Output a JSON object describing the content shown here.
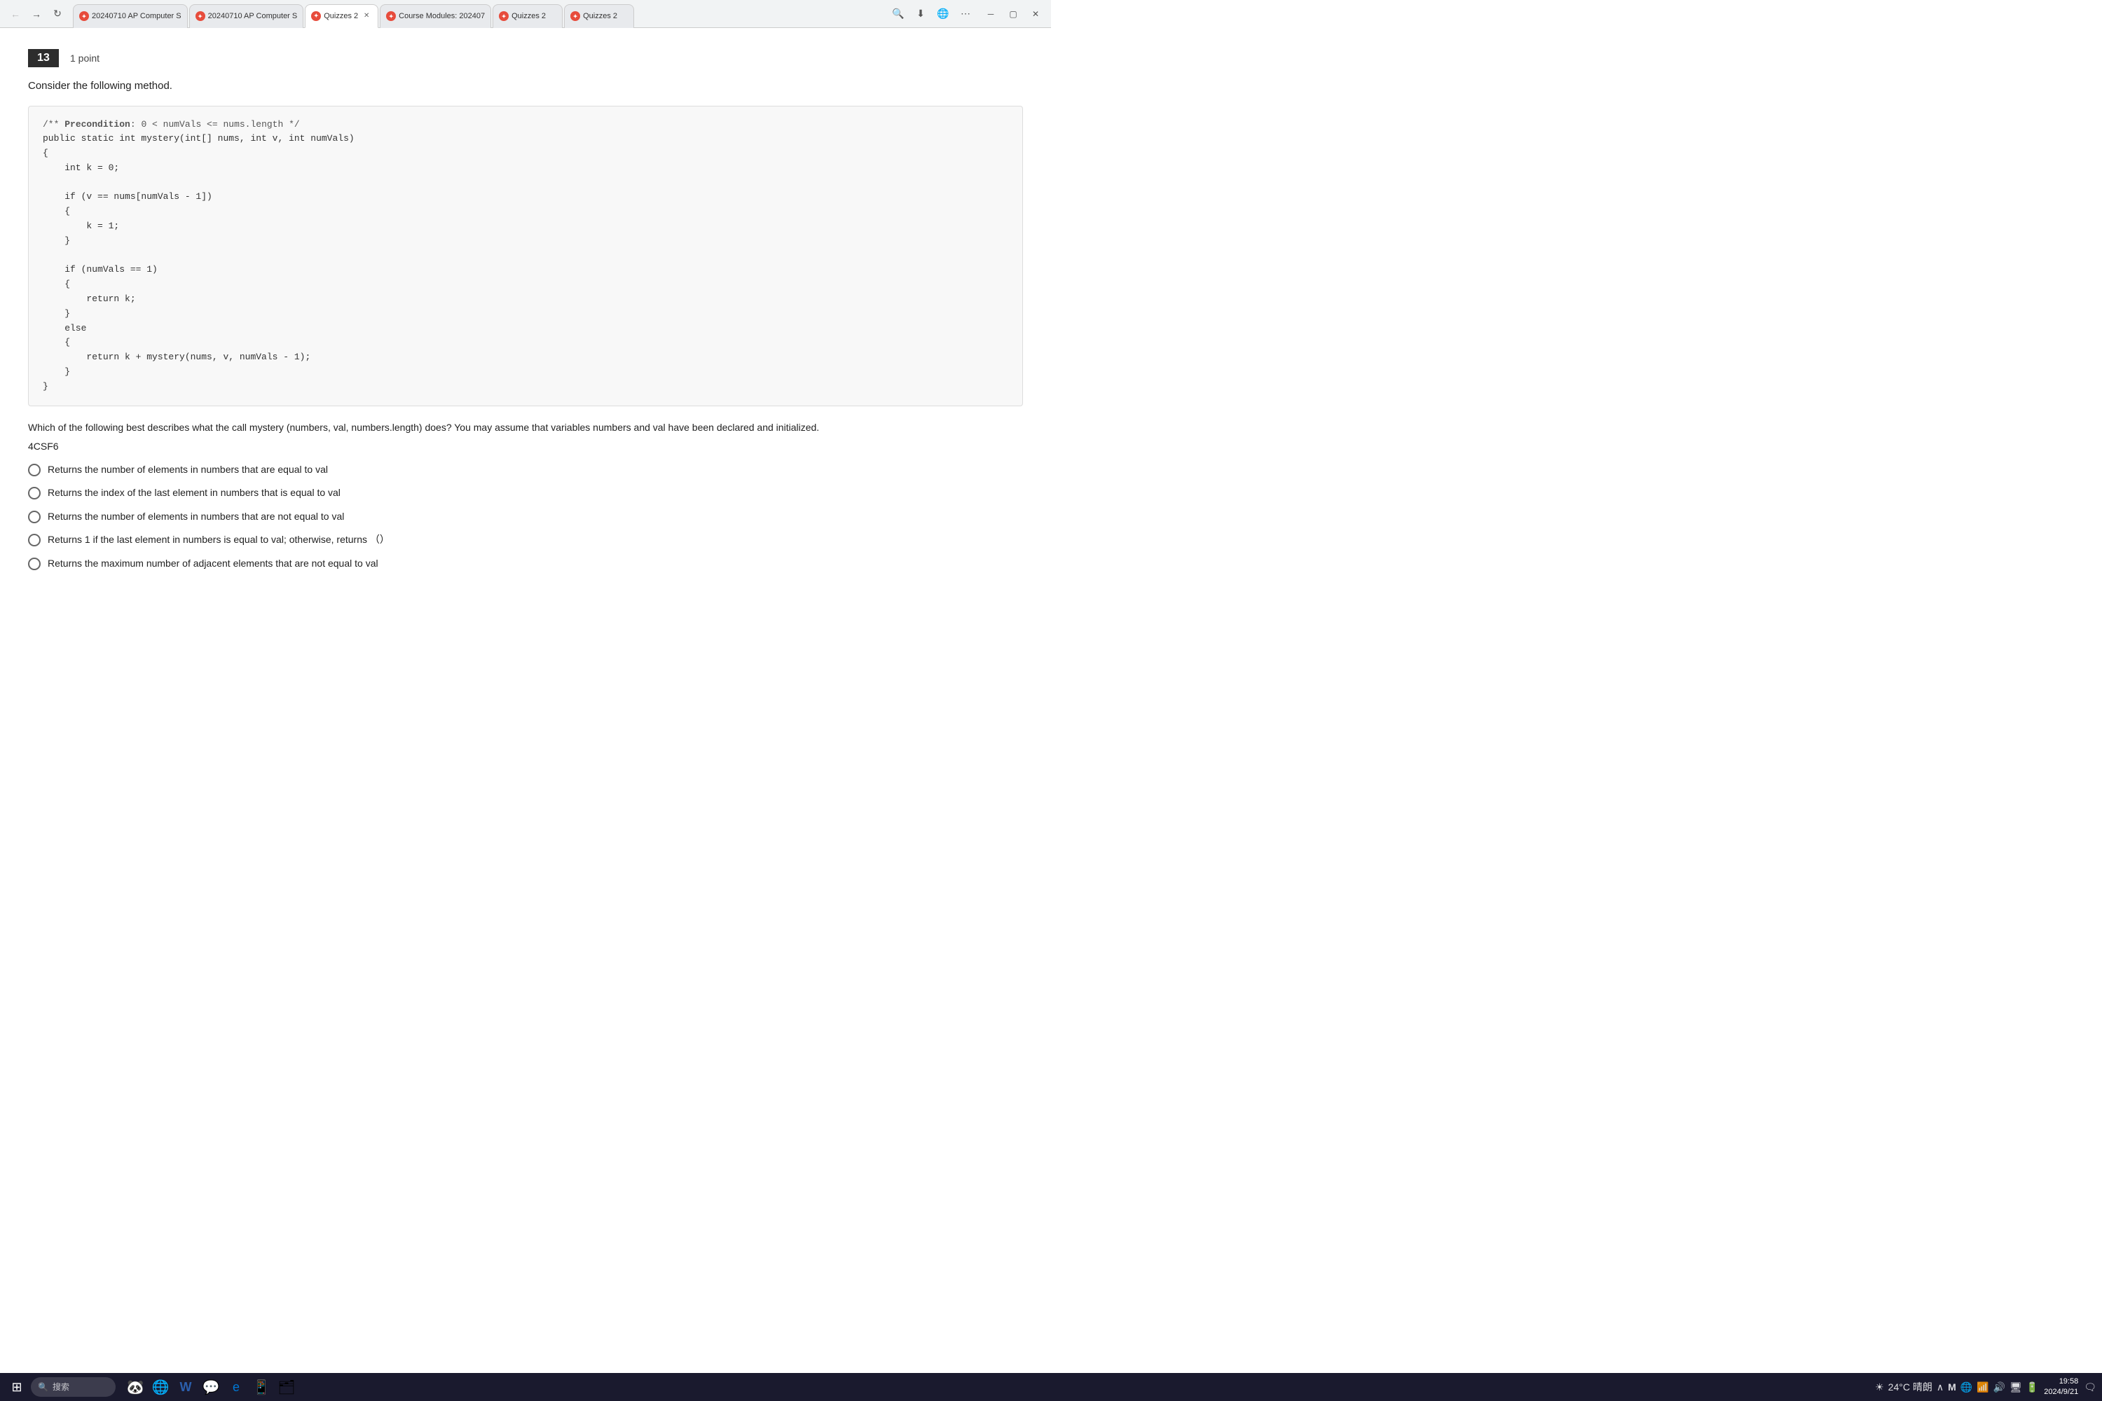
{
  "browser": {
    "tabs": [
      {
        "id": "tab1",
        "title": "20240710 AP Computer S",
        "active": false,
        "favicon": "🔴"
      },
      {
        "id": "tab2",
        "title": "20240710 AP Computer S",
        "active": false,
        "favicon": "🔴"
      },
      {
        "id": "tab3",
        "title": "Quizzes 2",
        "active": true,
        "favicon": "🔴",
        "closeable": true
      },
      {
        "id": "tab4",
        "title": "Course Modules: 202407",
        "active": false,
        "favicon": "🔴"
      },
      {
        "id": "tab5",
        "title": "Quizzes 2",
        "active": false,
        "favicon": "🔴"
      },
      {
        "id": "tab6",
        "title": "Quizzes 2",
        "active": false,
        "favicon": "🔴"
      }
    ],
    "actions": [
      "search",
      "download",
      "globe",
      "more"
    ]
  },
  "question": {
    "number": "13",
    "points": "1 point",
    "intro": "Consider the following method.",
    "code": "/** Precondition: 0 < numVals <= nums.length */\npublic static int mystery(int[] nums, int v, int numVals)\n{\n    int k = 0;\n\n    if (v == nums[numVals - 1])\n    {\n        k = 1;\n    }\n\n    if (numVals == 1)\n    {\n        return k;\n    }\n    else\n    {\n        return k + mystery(nums, v, numVals - 1);\n    }\n}",
    "question_text": "Which of the following best describes what the call mystery (numbers, val, numbers.length) does? You may assume that variables numbers and val have been declared and initialized.",
    "tag": "4CSF6",
    "options": [
      {
        "id": "A",
        "text": "Returns the number of elements in numbers that are equal to val"
      },
      {
        "id": "B",
        "text": "Returns the index of the last element in numbers that is equal to val"
      },
      {
        "id": "C",
        "text": "Returns the number of elements in numbers that are not equal to val"
      },
      {
        "id": "D",
        "text": "Returns 1 if the last element in numbers is equal to val; otherwise, returns （）"
      },
      {
        "id": "E",
        "text": "Returns the maximum number of adjacent elements that are not equal to val"
      }
    ]
  },
  "taskbar": {
    "search_placeholder": "搜索",
    "temperature": "24°C 晴朗",
    "time": "19:58",
    "date": "2024/9/21"
  }
}
